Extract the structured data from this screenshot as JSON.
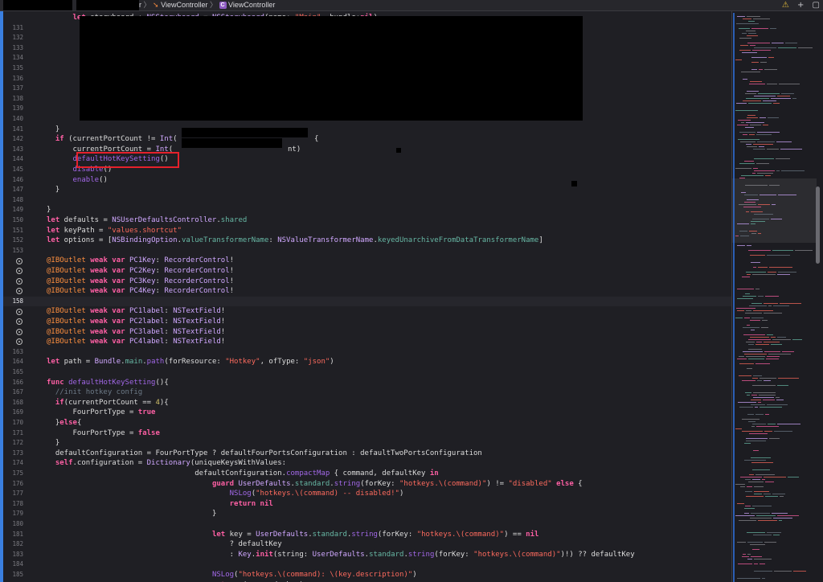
{
  "breadcrumb": {
    "item1": "r",
    "item2": "ViewController",
    "item3": "ViewController",
    "swift_icon": "swift-file-icon",
    "class_icon_letter": "C"
  },
  "toolbar_right": {
    "icons": [
      "warning-icon",
      "add-icon",
      "split-editor-icon"
    ],
    "warning": "⚠",
    "add": "+",
    "split": "▢"
  },
  "colors": {
    "background": "#1f1f24",
    "keyword": "#fc5fa3",
    "string": "#fc6a5d",
    "number": "#d0bf69",
    "type": "#d0a8ff",
    "highlight_box": "#e5212b",
    "gutter_bar": "#3a7fe0"
  },
  "current_line": "158",
  "lines": [
    {
      "n": "",
      "html": "<span class=\"kw\">let</span> storyboard : <span class=\"typ\">NSStoryboard</span> = <span class=\"typ\">NSStoryboard</span>(name: <span class=\"str\">\"Main\"</span>, bundle:<span class=\"kw\">nil</span>)",
      "indent": 4
    },
    {
      "n": "131",
      "html": "",
      "indent": 0
    },
    {
      "n": "132",
      "html": "",
      "indent": 0
    },
    {
      "n": "133",
      "html": "",
      "indent": 0
    },
    {
      "n": "134",
      "html": "",
      "indent": 0
    },
    {
      "n": "135",
      "html": "",
      "indent": 0
    },
    {
      "n": "136",
      "html": "",
      "indent": 0
    },
    {
      "n": "137",
      "html": "",
      "indent": 0
    },
    {
      "n": "138",
      "html": "",
      "indent": 0
    },
    {
      "n": "139",
      "html": "",
      "indent": 0
    },
    {
      "n": "140",
      "html": "",
      "indent": 0
    },
    {
      "n": "141",
      "html": "}",
      "indent": 2
    },
    {
      "n": "142",
      "html": "<span class=\"kw\">if</span> (currentPortCount != <span class=\"typ\">Int</span>(",
      "indent": 2
    },
    {
      "n": "143",
      "html": "currentPortCount = <span class=\"typ\">Int</span>(",
      "indent": 4
    },
    {
      "n": "144",
      "html": "<span class=\"fn\">defaultHotKeySetting</span>()",
      "indent": 4
    },
    {
      "n": "145",
      "html": "<span class=\"fn\">disable</span>()",
      "indent": 4
    },
    {
      "n": "146",
      "html": "<span class=\"fn\">enable</span>()",
      "indent": 4
    },
    {
      "n": "147",
      "html": "}",
      "indent": 2
    },
    {
      "n": "148",
      "html": "",
      "indent": 0
    },
    {
      "n": "149",
      "html": "}",
      "indent": 1
    },
    {
      "n": "150",
      "html": "<span class=\"kw\">let</span> defaults = <span class=\"typ\">NSUserDefaultsController</span>.<span class=\"prop\">shared</span>",
      "indent": 1
    },
    {
      "n": "151",
      "html": "<span class=\"kw\">let</span> keyPath = <span class=\"str\">\"values.shortcut\"</span>",
      "indent": 1
    },
    {
      "n": "152",
      "html": "<span class=\"kw\">let</span> options = [<span class=\"typ\">NSBindingOption</span>.<span class=\"prop\">valueTransformerName</span>: <span class=\"typ\">NSValueTransformerName</span>.<span class=\"prop\">keyedUnarchiveFromDataTransformerName</span>]",
      "indent": 1
    },
    {
      "n": "153",
      "html": "",
      "indent": 0
    },
    {
      "n": "",
      "bp": true,
      "html": "<span class=\"attr\">@IBOutlet</span> <span class=\"kw\">weak var</span> <span class=\"typ\">PC1Key</span>: <span class=\"typ\">RecorderControl</span>!",
      "indent": 1
    },
    {
      "n": "",
      "bp": true,
      "html": "<span class=\"attr\">@IBOutlet</span> <span class=\"kw\">weak var</span> <span class=\"typ\">PC2Key</span>: <span class=\"typ\">RecorderControl</span>!",
      "indent": 1
    },
    {
      "n": "",
      "bp": true,
      "html": "<span class=\"attr\">@IBOutlet</span> <span class=\"kw\">weak var</span> <span class=\"typ\">PC3Key</span>: <span class=\"typ\">RecorderControl</span>!",
      "indent": 1
    },
    {
      "n": "",
      "bp": true,
      "html": "<span class=\"attr\">@IBOutlet</span> <span class=\"kw\">weak var</span> <span class=\"typ\">PC4Key</span>: <span class=\"typ\">RecorderControl</span>!",
      "indent": 1
    },
    {
      "n": "158",
      "html": "",
      "indent": 0,
      "current": true
    },
    {
      "n": "",
      "bp": true,
      "html": "<span class=\"attr\">@IBOutlet</span> <span class=\"kw\">weak var</span> <span class=\"typ\">PC1label</span>: <span class=\"typ\">NSTextField</span>!",
      "indent": 1
    },
    {
      "n": "",
      "bp": true,
      "html": "<span class=\"attr\">@IBOutlet</span> <span class=\"kw\">weak var</span> <span class=\"typ\">PC2label</span>: <span class=\"typ\">NSTextField</span>!",
      "indent": 1
    },
    {
      "n": "",
      "bp": true,
      "html": "<span class=\"attr\">@IBOutlet</span> <span class=\"kw\">weak var</span> <span class=\"typ\">PC3label</span>: <span class=\"typ\">NSTextField</span>!",
      "indent": 1
    },
    {
      "n": "",
      "bp": true,
      "html": "<span class=\"attr\">@IBOutlet</span> <span class=\"kw\">weak var</span> <span class=\"typ\">PC4label</span>: <span class=\"typ\">NSTextField</span>!",
      "indent": 1
    },
    {
      "n": "163",
      "html": "",
      "indent": 0
    },
    {
      "n": "164",
      "html": "<span class=\"kw\">let</span> path = <span class=\"typ\">Bundle</span>.<span class=\"prop\">main</span>.<span class=\"fn\">path</span>(forResource: <span class=\"str\">\"Hotkey\"</span>, ofType: <span class=\"str\">\"json\"</span>)",
      "indent": 1
    },
    {
      "n": "165",
      "html": "",
      "indent": 0
    },
    {
      "n": "166",
      "html": "<span class=\"kw\">func</span> <span class=\"fn\">defaultHotKeySetting</span>(){",
      "indent": 1
    },
    {
      "n": "167",
      "html": "<span class=\"cmt\">//init hotkey config</span>",
      "indent": 2
    },
    {
      "n": "168",
      "html": "<span class=\"kw\">if</span>(currentPortCount == <span class=\"num\">4</span>){",
      "indent": 2
    },
    {
      "n": "169",
      "html": "FourPortType = <span class=\"kw\">true</span>",
      "indent": 4
    },
    {
      "n": "170",
      "html": "}<span class=\"kw\">else</span>{",
      "indent": 2
    },
    {
      "n": "171",
      "html": "FourPortType = <span class=\"kw\">false</span>",
      "indent": 4
    },
    {
      "n": "172",
      "html": "}",
      "indent": 2
    },
    {
      "n": "173",
      "html": "defaultConfiguration = FourPortType ? defaultFourPortsConfiguration : defaultTwoPortsConfiguration",
      "indent": 2
    },
    {
      "n": "174",
      "html": "<span class=\"kw\">self</span>.configuration = <span class=\"typ\">Dictionary</span>(uniqueKeysWithValues:",
      "indent": 2
    },
    {
      "n": "175",
      "html": "defaultConfiguration.<span class=\"fn\">compactMap</span> { command, defaultKey <span class=\"kw\">in</span>",
      "indent": 18
    },
    {
      "n": "176",
      "html": "<span class=\"kw\">guard</span> <span class=\"typ\">UserDefaults</span>.<span class=\"prop\">standard</span>.<span class=\"fn\">string</span>(forKey: <span class=\"str\">\"hotkeys.\\(command)\"</span>) != <span class=\"str\">\"disabled\"</span> <span class=\"kw\">else</span> {",
      "indent": 20
    },
    {
      "n": "177",
      "html": "<span class=\"fn\">NSLog</span>(<span class=\"str\">\"hotkeys.\\(command) -- disabled!\"</span>)",
      "indent": 22
    },
    {
      "n": "178",
      "html": "<span class=\"kw\">return nil</span>",
      "indent": 22
    },
    {
      "n": "179",
      "html": "}",
      "indent": 20
    },
    {
      "n": "180",
      "html": "",
      "indent": 0
    },
    {
      "n": "181",
      "html": "<span class=\"kw\">let</span> key = <span class=\"typ\">UserDefaults</span>.<span class=\"prop\">standard</span>.<span class=\"fn\">string</span>(forKey: <span class=\"str\">\"hotkeys.\\(command)\"</span>) == <span class=\"kw\">nil</span>",
      "indent": 20
    },
    {
      "n": "182",
      "html": "? defaultKey",
      "indent": 22
    },
    {
      "n": "183",
      "html": ": <span class=\"typ\">Key</span>.<span class=\"kw\">init</span>(string: <span class=\"typ\">UserDefaults</span>.<span class=\"prop\">standard</span>.<span class=\"fn\">string</span>(forKey: <span class=\"str\">\"hotkeys.\\(command)\"</span>)!) ?? defaultKey",
      "indent": 22
    },
    {
      "n": "184",
      "html": "",
      "indent": 0
    },
    {
      "n": "185",
      "html": "<span class=\"fn\">NSLog</span>(<span class=\"str\">\"hotkeys.\\(command): \\(key.description)\"</span>)",
      "indent": 20
    },
    {
      "n": "",
      "html": "<span class=\"kw\">return</span> (command, key)",
      "indent": 20
    }
  ],
  "tail_142": "{",
  "tail_143": "nt)"
}
